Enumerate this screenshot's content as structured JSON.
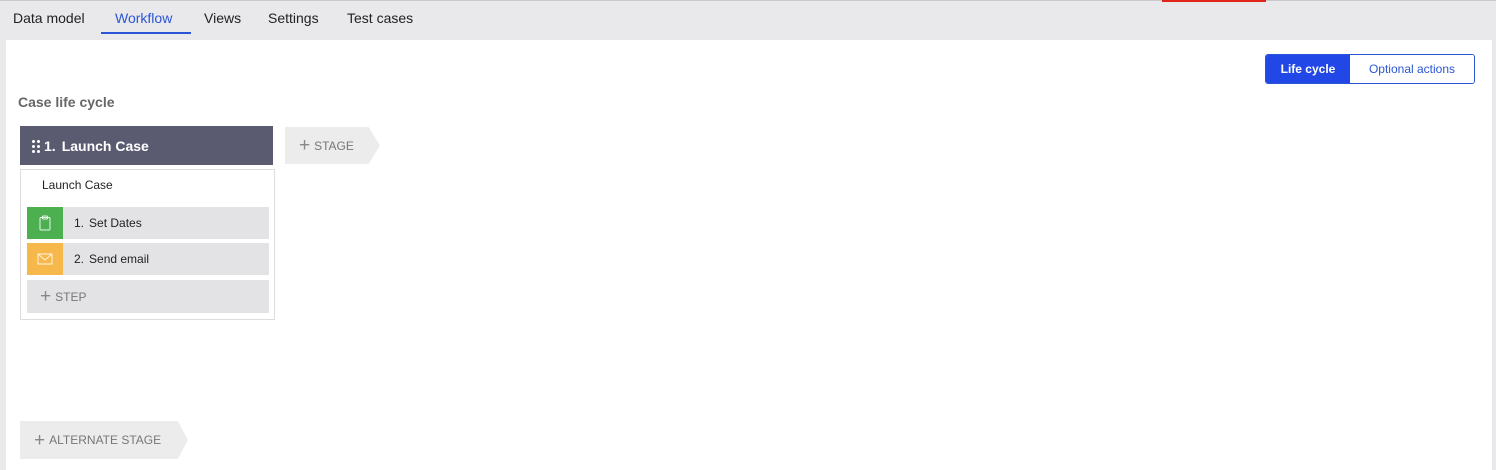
{
  "tabs": [
    {
      "label": "Data model"
    },
    {
      "label": "Workflow"
    },
    {
      "label": "Views"
    },
    {
      "label": "Settings"
    },
    {
      "label": "Test cases"
    }
  ],
  "active_tab": "Workflow",
  "view_toggle": {
    "life_cycle_label": "Life cycle",
    "optional_actions_label": "Optional actions",
    "selected": "Life cycle"
  },
  "section_title": "Case life cycle",
  "stage": {
    "number": "1.",
    "name": "Launch Case",
    "process_name": "Launch Case",
    "steps": [
      {
        "number": "1.",
        "label": "Set Dates",
        "icon": "clipboard-icon",
        "color": "#4caf50"
      },
      {
        "number": "2.",
        "label": "Send email",
        "icon": "envelope-icon",
        "color": "#f7b84b"
      }
    ],
    "add_step_label": "STEP"
  },
  "add_stage_label": "STAGE",
  "add_alternate_stage_label": "ALTERNATE STAGE",
  "colors": {
    "accent": "#2b55d6",
    "stage_header": "#5a5b70"
  }
}
